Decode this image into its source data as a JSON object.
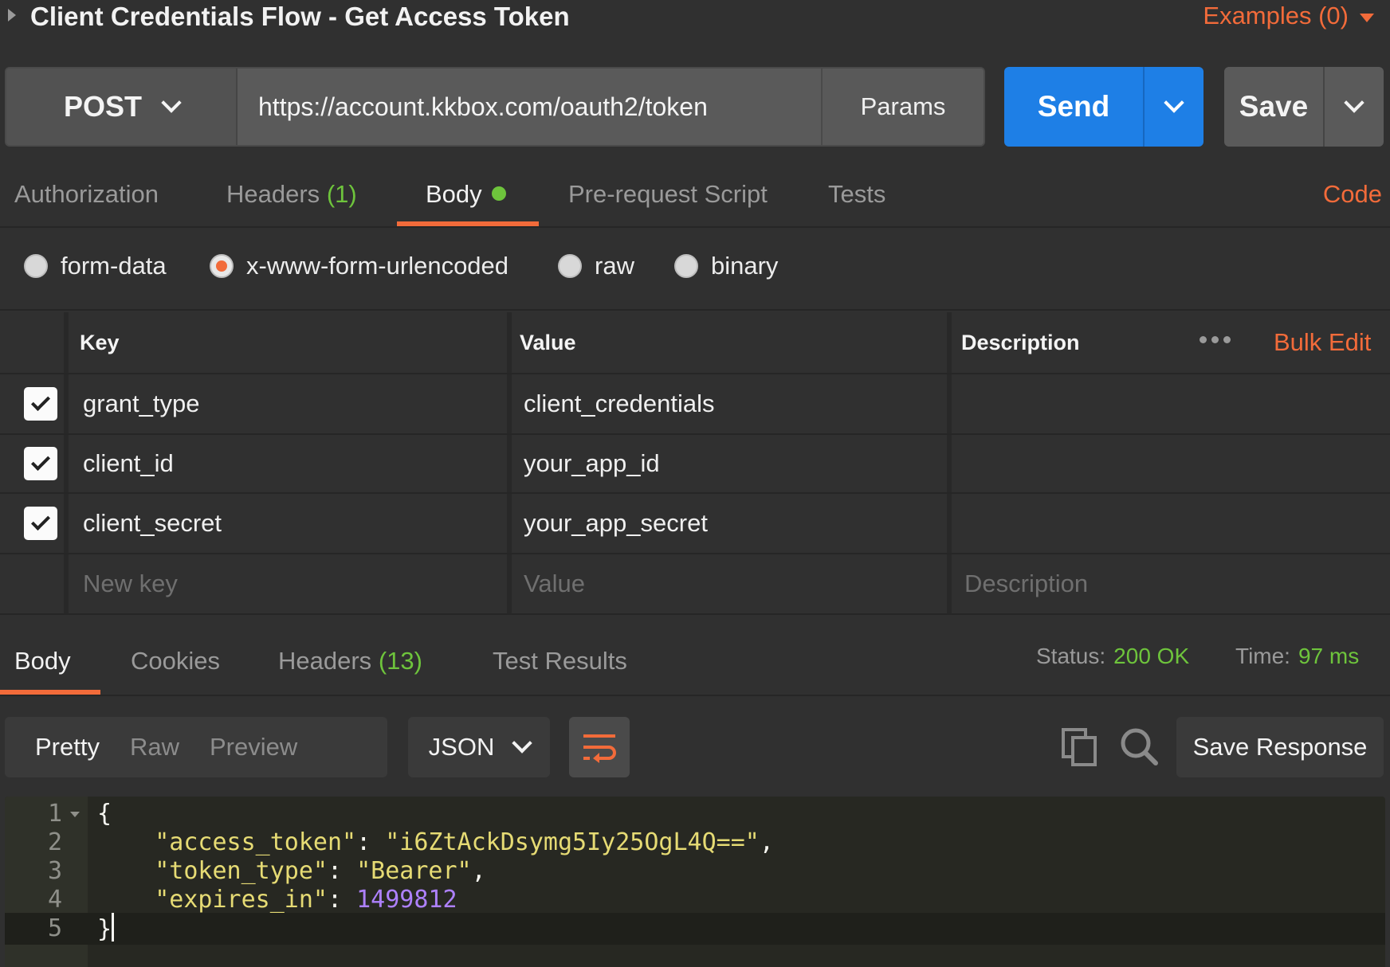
{
  "request": {
    "title": "Client Credentials Flow - Get Access Token",
    "examples_label": "Examples (0)",
    "method": "POST",
    "url": "https://account.kkbox.com/oauth2/token",
    "params_label": "Params",
    "send_label": "Send",
    "save_label": "Save"
  },
  "request_tabs": {
    "authorization": "Authorization",
    "headers": "Headers",
    "headers_count": "(1)",
    "body": "Body",
    "pre_request": "Pre-request Script",
    "tests": "Tests",
    "code": "Code"
  },
  "body_types": [
    "form-data",
    "x-www-form-urlencoded",
    "raw",
    "binary"
  ],
  "body_type_selected": "x-www-form-urlencoded",
  "kv_table": {
    "headers": {
      "key": "Key",
      "value": "Value",
      "description": "Description",
      "bulk_edit": "Bulk Edit"
    },
    "rows": [
      {
        "checked": true,
        "key": "grant_type",
        "value": "client_credentials",
        "description": ""
      },
      {
        "checked": true,
        "key": "client_id",
        "value": "your_app_id",
        "description": ""
      },
      {
        "checked": true,
        "key": "client_secret",
        "value": "your_app_secret",
        "description": ""
      }
    ],
    "placeholder": {
      "key": "New key",
      "value": "Value",
      "description": "Description"
    }
  },
  "response_tabs": {
    "body": "Body",
    "cookies": "Cookies",
    "headers": "Headers",
    "headers_count": "(13)",
    "test_results": "Test Results",
    "status_label": "Status:",
    "status_value": "200 OK",
    "time_label": "Time:",
    "time_value": "97 ms"
  },
  "response_toolbar": {
    "pretty": "Pretty",
    "raw": "Raw",
    "preview": "Preview",
    "format": "JSON",
    "save_response": "Save Response"
  },
  "response_body": {
    "line_numbers": [
      "1",
      "2",
      "3",
      "4",
      "5"
    ],
    "open_brace": "{",
    "close_brace": "}",
    "access_token_key": "\"access_token\"",
    "access_token_value": "\"i6ZtAckDsymg5Iy25OgL4Q==\"",
    "token_type_key": "\"token_type\"",
    "token_type_value": "\"Bearer\"",
    "expires_in_key": "\"expires_in\"",
    "expires_in_value": "1499812"
  },
  "colors": {
    "accent_orange": "#f26b3a",
    "send_blue": "#1e7fe6",
    "success_green": "#6ec43c"
  }
}
